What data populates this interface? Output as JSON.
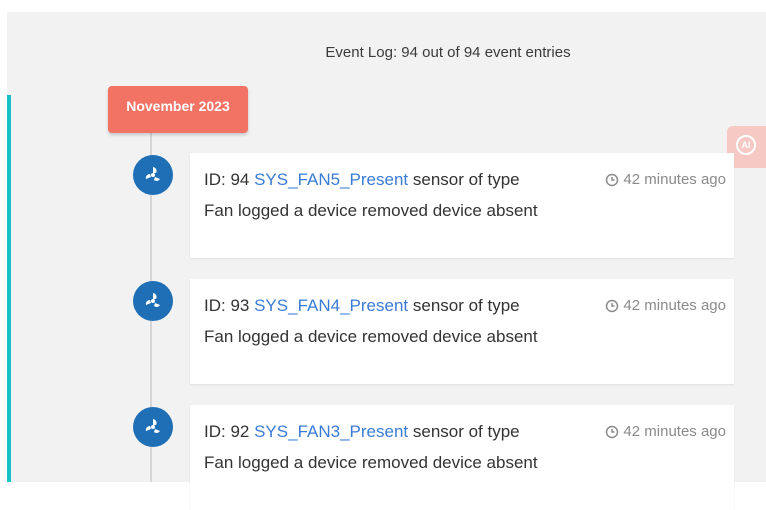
{
  "summary": "Event Log: 94 out of 94 event entries",
  "month_label": "November 2023",
  "ai_badge": "AI",
  "colors": {
    "accent": "#16c0c7",
    "badge": "#f27264",
    "icon_bg": "#1f6fb6",
    "link": "#3a7bd5"
  },
  "events": [
    {
      "id_text": "ID: 94",
      "sensor": "SYS_FAN5_Present",
      "type_text": "sensor of type",
      "time": "42 minutes ago",
      "message": "Fan logged a device removed device absent",
      "icon": "fan-icon"
    },
    {
      "id_text": "ID: 93",
      "sensor": "SYS_FAN4_Present",
      "type_text": "sensor of type",
      "time": "42 minutes ago",
      "message": "Fan logged a device removed device absent",
      "icon": "fan-icon"
    },
    {
      "id_text": "ID: 92",
      "sensor": "SYS_FAN3_Present",
      "type_text": "sensor of type",
      "time": "42 minutes ago",
      "message": "Fan logged a device removed device absent",
      "icon": "fan-icon"
    }
  ]
}
